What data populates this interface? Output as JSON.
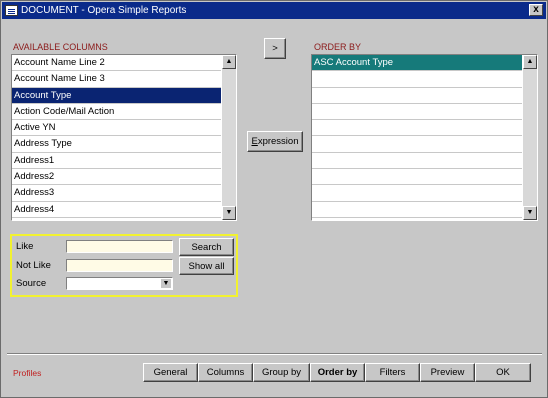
{
  "window": {
    "title": "DOCUMENT - Opera Simple Reports",
    "close_label": "x"
  },
  "available": {
    "header": "AVAILABLE COLUMNS",
    "items": [
      "Account Name Line 2",
      "Account Name Line 3",
      "Account Type",
      "Action Code/Mail Action",
      "Active YN",
      "Address Type",
      "Address1",
      "Address2",
      "Address3",
      "Address4"
    ],
    "selected_index": 2
  },
  "order_by": {
    "header": "ORDER BY",
    "items": [
      "ASC   Account Type"
    ]
  },
  "buttons": {
    "move_right": ">",
    "expression": "Expression"
  },
  "filter": {
    "like_label": "Like",
    "not_like_label": "Not Like",
    "source_label": "Source",
    "like_value": "",
    "not_like_value": "",
    "source_value": "",
    "search_label": "Search",
    "show_all_label": "Show all"
  },
  "footer": {
    "profiles_label": "Profiles",
    "tabs": [
      "General",
      "Columns",
      "Group by",
      "Order by",
      "Filters",
      "Preview",
      "OK"
    ]
  }
}
